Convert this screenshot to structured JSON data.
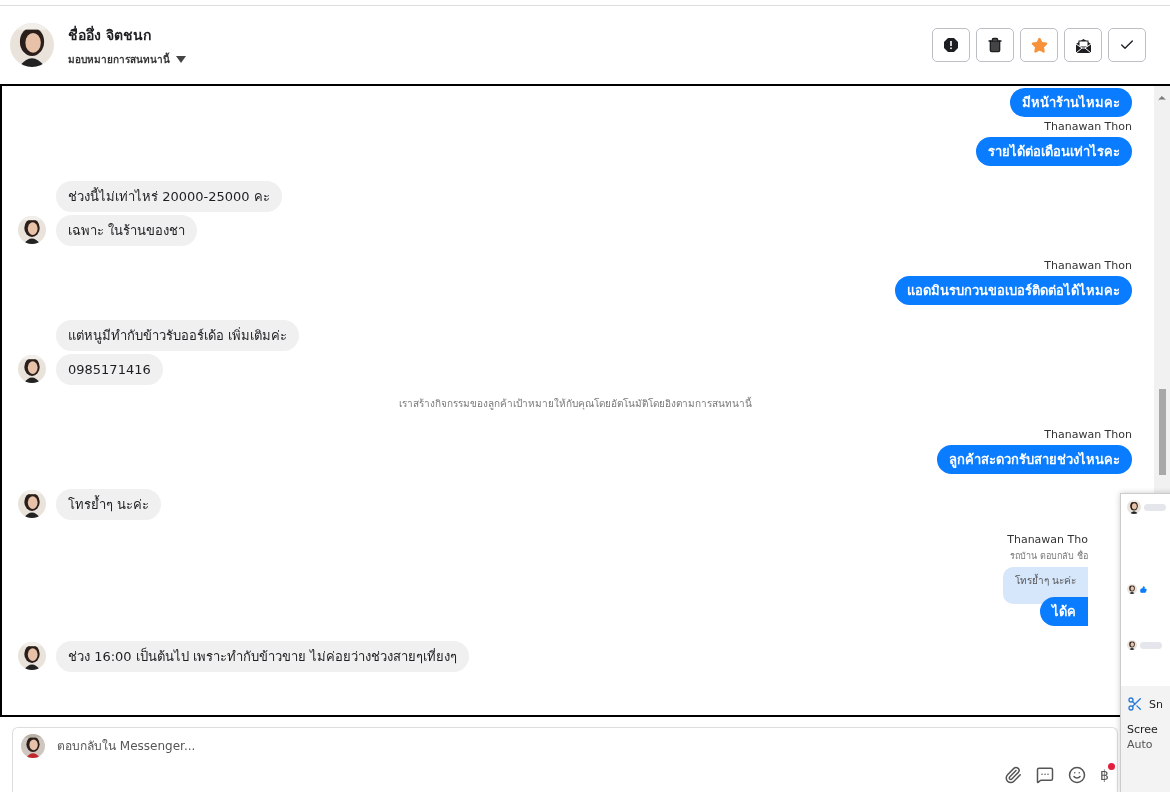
{
  "header": {
    "name": "ชื่ออึ่ง จิตชนก",
    "assign": "มอบหมายการสนทนานี้"
  },
  "actions": [
    {
      "kind": "alert",
      "active": false
    },
    {
      "kind": "trash",
      "active": false
    },
    {
      "kind": "star",
      "active": true
    },
    {
      "kind": "mail",
      "active": false
    },
    {
      "kind": "check",
      "active": false
    }
  ],
  "messages": [
    {
      "kind": "out",
      "text": "มีหน้าร้านไหมคะ",
      "cut": false
    },
    {
      "kind": "name",
      "text": "Thanawan Thon",
      "cut": false
    },
    {
      "kind": "out",
      "text": "รายได้ต่อเดือนเท่าไรคะ",
      "cut": false
    },
    {
      "kind": "in",
      "text": "ช่วงนี้ไม่เท่าไหร่ 20000-25000 คะ",
      "avatar": false
    },
    {
      "kind": "in",
      "text": "เฉพาะ ในร้านของชา",
      "avatar": true
    },
    {
      "kind": "name",
      "text": "Thanawan Thon",
      "cut": false
    },
    {
      "kind": "out",
      "text": "แอดมินรบกวนขอเบอร์ติดต่อได้ไหมคะ",
      "cut": false
    },
    {
      "kind": "in",
      "text": "แต่หนูมีทำกับข้าวรับออร์เด้อ เพิ่มเติมค่ะ",
      "avatar": false
    },
    {
      "kind": "in",
      "text": "0985171416",
      "avatar": true
    },
    {
      "kind": "system",
      "text": "เราสร้างกิจกรรมของลูกค้าเป้าหมายให้กับคุณโดยอัตโนมัติโดยอิงตามการสนทนานี้"
    },
    {
      "kind": "name",
      "text": "Thanawan Thon",
      "cut": false
    },
    {
      "kind": "out",
      "text": "ลูกค้าสะดวกรับสายช่วงไหนคะ",
      "cut": false
    },
    {
      "kind": "in",
      "text": "โทรย้ำๆ นะค่ะ",
      "avatar": true
    },
    {
      "kind": "name",
      "text": "Thanawan Tho",
      "cut": true
    },
    {
      "kind": "reply_note",
      "text": "รถบ้าน ตอบกลับ ชื่อ",
      "cut": true
    },
    {
      "kind": "quoted",
      "text": "โทรย้ำๆ นะค่ะ",
      "cut": true
    },
    {
      "kind": "out",
      "text": "ได้ค",
      "cut": true
    },
    {
      "kind": "in",
      "text": "ช่วง 16:00 เป็นต้นไป เพราะทำกับข้าวขาย ไม่ค่อยว่างช่วงสายๆเที่ยงๆ",
      "avatar": true
    }
  ],
  "composer": {
    "placeholder": "ตอบกลับใน Messenger...",
    "currency": "฿"
  },
  "notification": {
    "app": "Sn",
    "title": "Scree",
    "body": "Auto"
  }
}
